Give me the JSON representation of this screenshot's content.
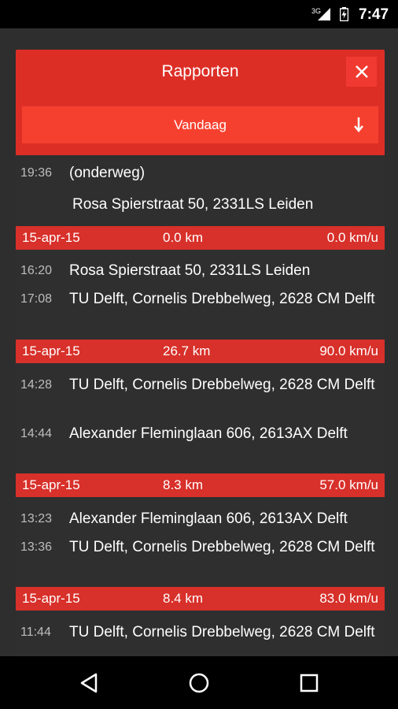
{
  "status": {
    "network": "3G",
    "time": "7:47"
  },
  "dialog": {
    "title": "Rapporten",
    "filter": "Vandaag"
  },
  "trips": [
    {
      "stops": [
        {
          "time": "19:36",
          "address": "(onderweg)"
        },
        {
          "time": "",
          "address": "Rosa Spierstraat 50, 2331LS Leiden"
        }
      ],
      "summary": {
        "date": "15-apr-15",
        "distance": "0.0 km",
        "speed": "0.0 km/u"
      }
    },
    {
      "stops": [
        {
          "time": "16:20",
          "address": "Rosa Spierstraat 50, 2331LS Leiden"
        },
        {
          "time": "17:08",
          "address": "TU Delft, Cornelis Drebbelweg, 2628 CM Delft"
        }
      ],
      "summary": {
        "date": "15-apr-15",
        "distance": "26.7 km",
        "speed": "90.0 km/u"
      }
    },
    {
      "stops": [
        {
          "time": "14:28",
          "address": "TU Delft, Cornelis Drebbelweg, 2628 CM Delft"
        },
        {
          "time": "14:44",
          "address": "Alexander Fleminglaan 606, 2613AX Delft"
        }
      ],
      "summary": {
        "date": "15-apr-15",
        "distance": "8.3 km",
        "speed": "57.0 km/u"
      }
    },
    {
      "stops": [
        {
          "time": "13:23",
          "address": "Alexander Fleminglaan 606, 2613AX Delft"
        },
        {
          "time": "13:36",
          "address": "TU Delft, Cornelis Drebbelweg, 2628 CM Delft"
        }
      ],
      "summary": {
        "date": "15-apr-15",
        "distance": "8.4 km",
        "speed": "83.0 km/u"
      }
    },
    {
      "stops": [
        {
          "time": "11:44",
          "address": "TU Delft, Cornelis Drebbelweg, 2628 CM Delft"
        }
      ]
    }
  ],
  "icons": {
    "close": "close-icon",
    "filter_arrow": "arrow-down-icon",
    "nav": [
      "back-icon",
      "home-icon",
      "recents-icon"
    ]
  },
  "colors": {
    "header": "#dd2e26",
    "filter": "#f6402f",
    "summary_bar": "#d8302a",
    "background": "#2f2f2f"
  }
}
